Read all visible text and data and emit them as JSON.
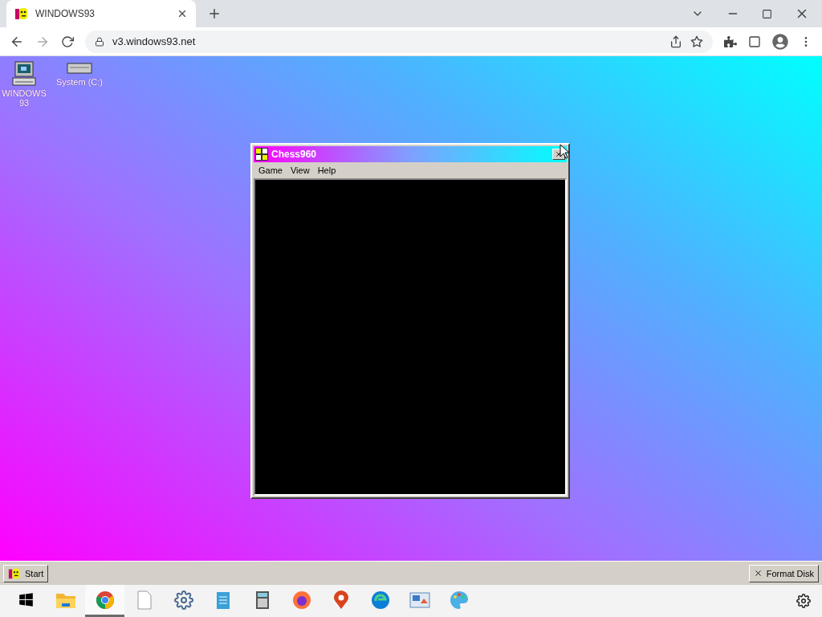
{
  "browser": {
    "tabs": [
      {
        "title": "WINDOWS93",
        "selected": true
      }
    ],
    "url": "v3.windows93.net"
  },
  "desktop": {
    "icons": [
      {
        "kind": "computer",
        "label": "WINDOWS 93"
      },
      {
        "kind": "drive",
        "label": "System (C:)"
      }
    ]
  },
  "window": {
    "title": "Chess960",
    "menu": [
      "Game",
      "View",
      "Help"
    ]
  },
  "taskbar": {
    "start": "Start",
    "tasks": [
      {
        "label": "Format Disk"
      }
    ]
  },
  "os_taskbar": {
    "apps": [
      {
        "kind": "folder",
        "selected": false
      },
      {
        "kind": "chrome",
        "selected": true
      },
      {
        "kind": "file",
        "selected": false
      },
      {
        "kind": "gear",
        "selected": false
      },
      {
        "kind": "notepad",
        "selected": false
      },
      {
        "kind": "calculator",
        "selected": false
      },
      {
        "kind": "firefox",
        "selected": false
      },
      {
        "kind": "pin",
        "selected": false
      },
      {
        "kind": "edge",
        "selected": false
      },
      {
        "kind": "display",
        "selected": false
      },
      {
        "kind": "palette",
        "selected": false
      }
    ]
  }
}
